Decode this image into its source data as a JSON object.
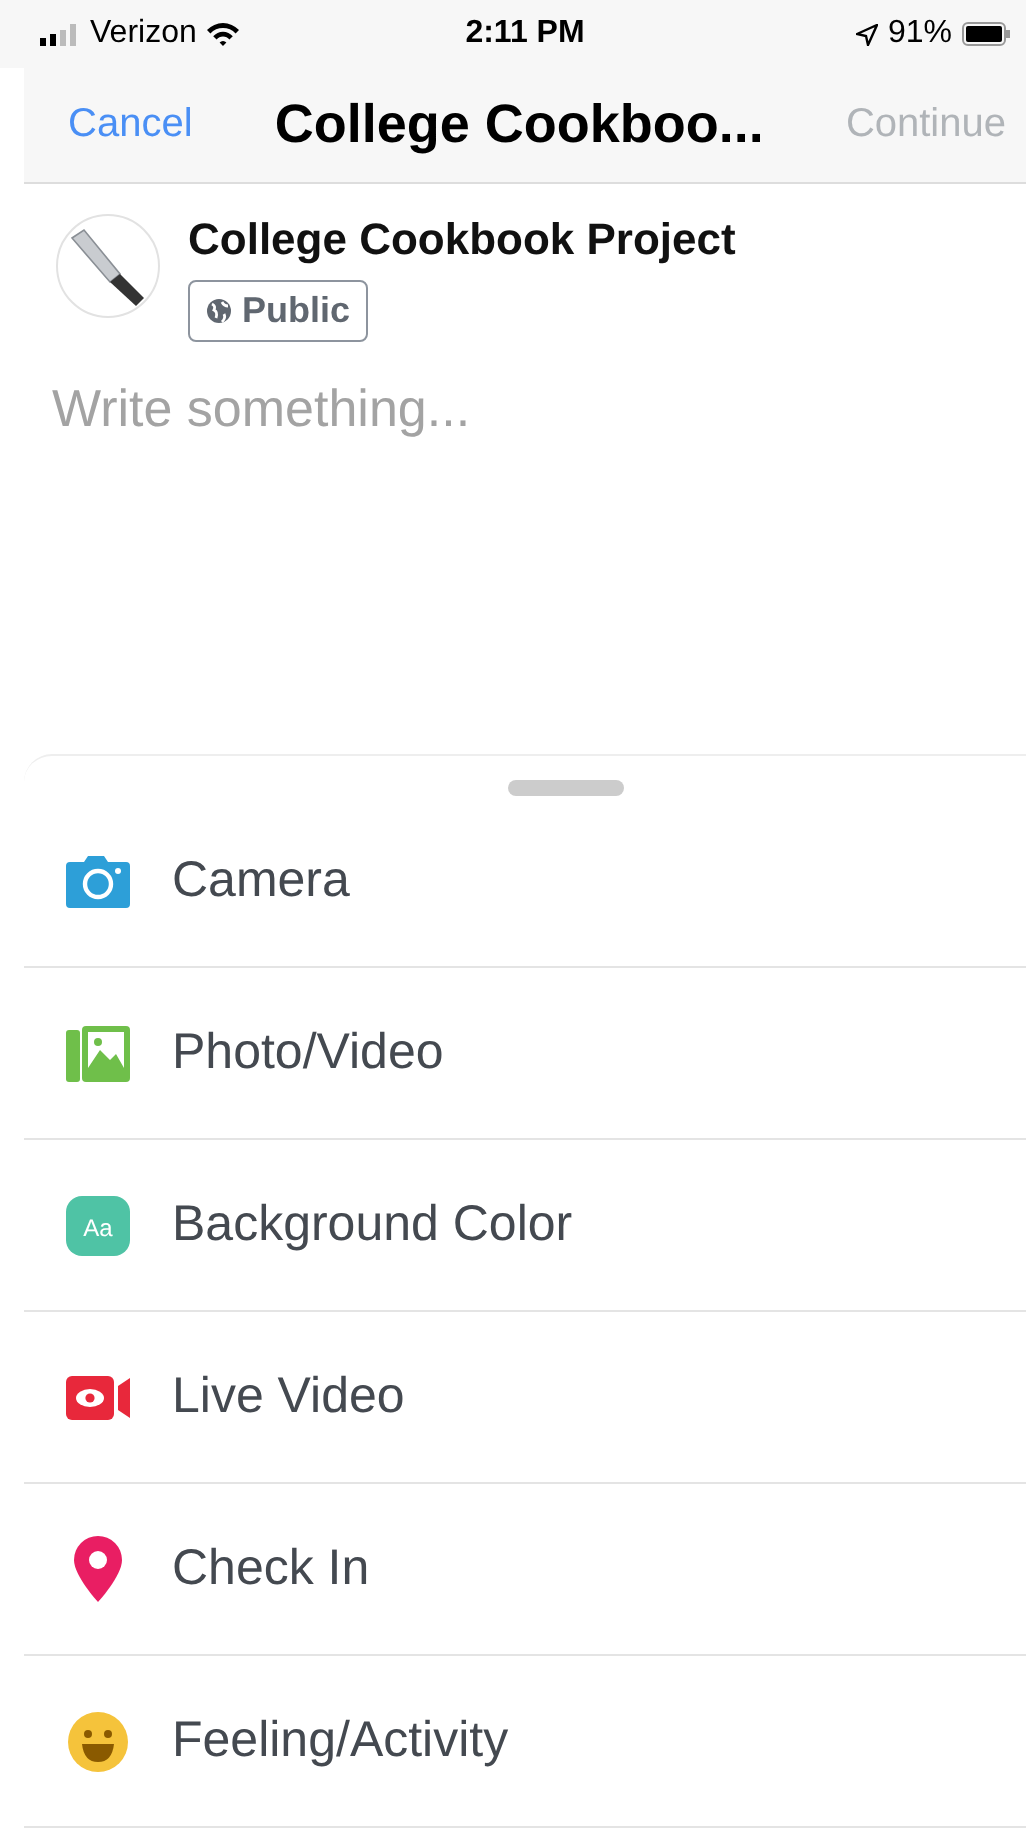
{
  "status_bar": {
    "carrier": "Verizon",
    "time": "2:11 PM",
    "battery": "91%"
  },
  "nav": {
    "cancel": "Cancel",
    "title": "College Cookboo...",
    "continue": {
      "label": "Continue",
      "disabled": true
    }
  },
  "post": {
    "group": "College Cookbook Project",
    "audience": "Public",
    "placeholder": "Write something..."
  },
  "options": [
    {
      "kind": "camera",
      "label": "Camera"
    },
    {
      "kind": "photo",
      "label": "Photo/Video"
    },
    {
      "kind": "background",
      "label": "Background Color",
      "icon_text": "Aa"
    },
    {
      "kind": "live",
      "label": "Live Video"
    },
    {
      "kind": "checkin",
      "label": "Check In"
    },
    {
      "kind": "feeling",
      "label": "Feeling/Activity"
    }
  ]
}
